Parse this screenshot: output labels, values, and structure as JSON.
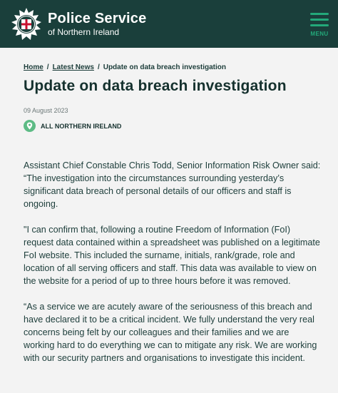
{
  "header": {
    "title": "Police Service",
    "subtitle": "of Northern Ireland",
    "menu_label": "MENU"
  },
  "breadcrumb": {
    "home": "Home",
    "latest": "Latest News",
    "current": "Update on data breach investigation",
    "separator": "/"
  },
  "article": {
    "title": "Update on data breach investigation",
    "date": "09 August 2023",
    "region": "ALL NORTHERN IRELAND",
    "paragraphs": [
      "Assistant Chief Constable Chris Todd, Senior Information Risk Owner said: “The investigation into the circumstances surrounding yesterday’s significant data breach of personal details of our officers and staff is ongoing.",
      "\"I can confirm that, following a routine Freedom of Information (FoI) request data contained within a spreadsheet was published on a legitimate FoI website.  This included the surname, initials, rank/grade, role and location of all serving officers and staff.  This data was available to view on the website for a period of up to three hours before it was removed.",
      "“As a service we are acutely aware of the seriousness of this breach and have declared it to be a critical incident.  We fully understand the very real concerns being felt by our colleagues and their families and we are working hard to do everything we can to mitigate any risk.  We are working with our security partners and organisations to investigate this incident."
    ]
  },
  "colors": {
    "header_bg": "#1a3f3b",
    "accent": "#23a97a",
    "pin": "#5dbb85",
    "text": "#1c3d3a"
  }
}
